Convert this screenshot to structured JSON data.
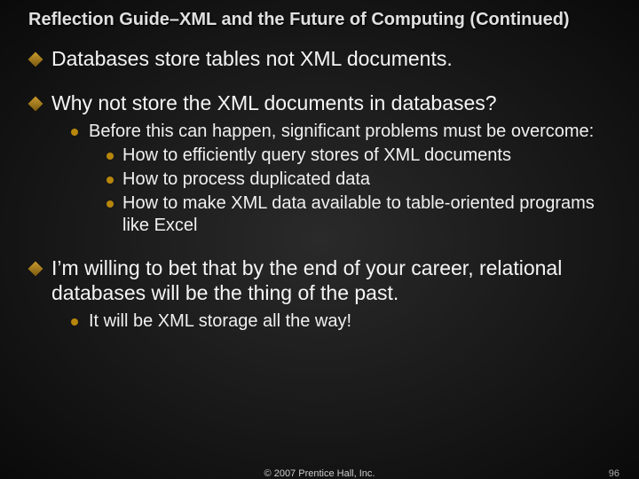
{
  "title": "Reflection Guide–XML and the Future of Computing (Continued)",
  "bullets": {
    "b0": "Databases store tables not XML documents.",
    "b1": "Why not store the XML documents in databases?",
    "b1_sub": {
      "s0": "Before this can happen, significant problems must be overcome:",
      "s0_sub": {
        "t0": "How to efficiently query stores of XML documents",
        "t1": "How to process duplicated data",
        "t2": "How to make XML data available to table-oriented programs like Excel"
      }
    },
    "b2": "I’m willing to bet that by the end of your career, relational databases will be the thing of the past.",
    "b2_sub": {
      "s0": "It will be XML storage all the way!"
    }
  },
  "footer": {
    "copyright": "© 2007 Prentice Hall, Inc.",
    "page": "96"
  }
}
